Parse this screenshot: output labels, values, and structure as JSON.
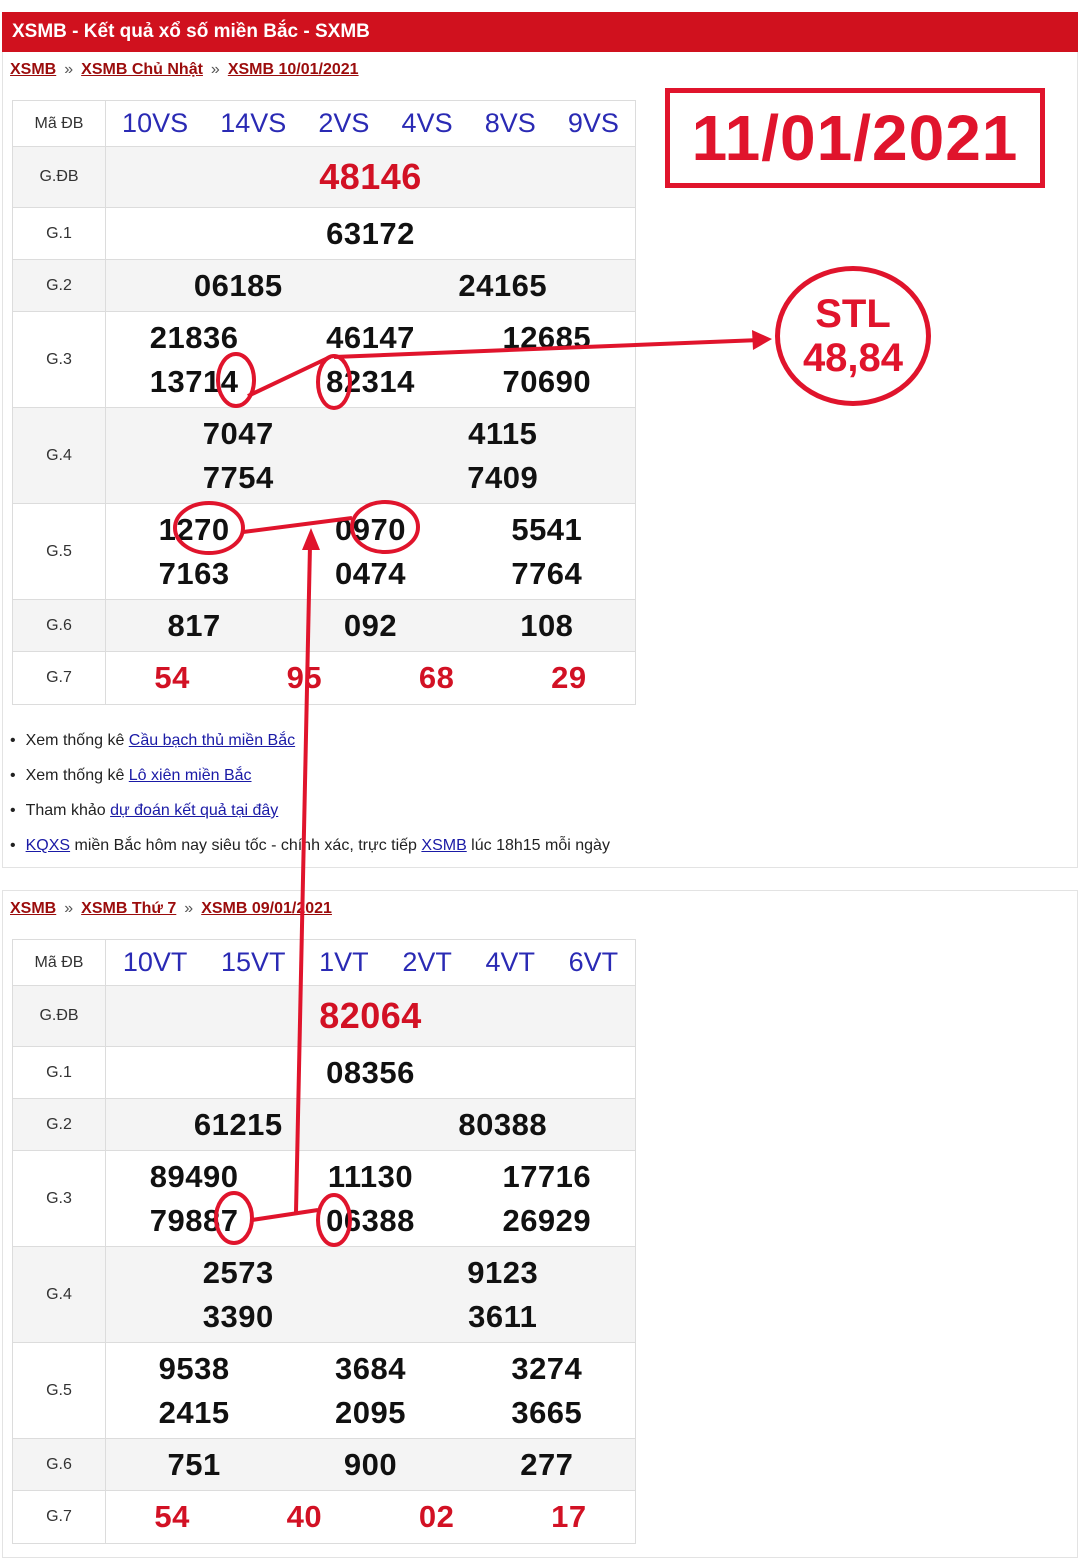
{
  "header": {
    "title": "XSMB - Kết quả xổ số miền Bắc - SXMB"
  },
  "annotations": {
    "date": "11/01/2021",
    "stl_label": "STL",
    "stl_value": "48,84"
  },
  "result1": {
    "breadcrumb": [
      "XSMB",
      "XSMB Chủ Nhật",
      "XSMB 10/01/2021"
    ],
    "madb_label": "Mã ĐB",
    "madb": [
      "10VS",
      "14VS",
      "2VS",
      "4VS",
      "8VS",
      "9VS"
    ],
    "labels": {
      "gdb": "G.ĐB",
      "g1": "G.1",
      "g2": "G.2",
      "g3": "G.3",
      "g4": "G.4",
      "g5": "G.5",
      "g6": "G.6",
      "g7": "G.7"
    },
    "gdb": "48146",
    "g1": "63172",
    "g2": [
      "06185",
      "24165"
    ],
    "g3": [
      "21836",
      "46147",
      "12685",
      "13714",
      "82314",
      "70690"
    ],
    "g4": [
      "7047",
      "4115",
      "7754",
      "7409"
    ],
    "g5": [
      "1270",
      "0970",
      "5541",
      "7163",
      "0474",
      "7764"
    ],
    "g6": [
      "817",
      "092",
      "108"
    ],
    "g7": [
      "54",
      "95",
      "68",
      "29"
    ]
  },
  "links": [
    {
      "prefix": "Xem thống kê ",
      "link": "Cầu bạch thủ miền Bắc",
      "suffix": ""
    },
    {
      "prefix": "Xem thống kê ",
      "link": "Lô xiên miền Bắc",
      "suffix": ""
    },
    {
      "prefix": "Tham khảo ",
      "link": "dự đoán kết quả tại đây",
      "suffix": ""
    },
    {
      "prefix": "",
      "link": "KQXS",
      "mid": " miền Bắc hôm nay siêu tốc - chính xác, trực tiếp ",
      "link2": "XSMB",
      "suffix": " lúc 18h15 mỗi ngày"
    }
  ],
  "result2": {
    "breadcrumb": [
      "XSMB",
      "XSMB Thứ 7",
      "XSMB 09/01/2021"
    ],
    "madb_label": "Mã ĐB",
    "madb": [
      "10VT",
      "15VT",
      "1VT",
      "2VT",
      "4VT",
      "6VT"
    ],
    "labels": {
      "gdb": "G.ĐB",
      "g1": "G.1",
      "g2": "G.2",
      "g3": "G.3",
      "g4": "G.4",
      "g5": "G.5",
      "g6": "G.6",
      "g7": "G.7"
    },
    "gdb": "82064",
    "g1": "08356",
    "g2": [
      "61215",
      "80388"
    ],
    "g3": [
      "89490",
      "11130",
      "17716",
      "79887",
      "06388",
      "26929"
    ],
    "g4": [
      "2573",
      "9123",
      "3390",
      "3611"
    ],
    "g5": [
      "9538",
      "3684",
      "3274",
      "2415",
      "2095",
      "3665"
    ],
    "g6": [
      "751",
      "900",
      "277"
    ],
    "g7": [
      "54",
      "40",
      "02",
      "17"
    ]
  }
}
